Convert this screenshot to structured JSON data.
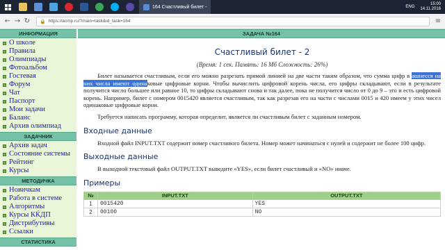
{
  "taskbar": {
    "task_title": "164 Счастливый билет -",
    "lang": "ENG",
    "time": "15:00",
    "date": "14.11.2016"
  },
  "browser": {
    "url": "https://acmp.ru/?main=task&id_task=164"
  },
  "sidebar": {
    "sections": [
      {
        "title": "ИНФОРМАЦИЯ",
        "items": [
          "О школе",
          "Правила",
          "Олимпиады",
          "Фотоальбом",
          "Гостевая",
          "Форум",
          "Чат",
          "Паспорт",
          "Мои задачи",
          "Баланс",
          "Архив олимпиад"
        ]
      },
      {
        "title": "ЗАДАЧНИК",
        "items": [
          "Архив задач",
          "Состояние системы",
          "Рейтинг",
          "Курсы"
        ]
      },
      {
        "title": "МЕТОДИЧКА",
        "items": [
          "Новичкам",
          "Работа в системе",
          "Алгоритмы",
          "Курсы КЌДП",
          "Дистрибутивы",
          "Ссылки"
        ]
      },
      {
        "title": "СТАТИСТИКА",
        "items": []
      }
    ]
  },
  "task": {
    "header": "ЗАДАЧА №164",
    "title": "Счастливый билет - 2",
    "limits": "(Время: 1 сек. Память: 16 Мб Сложность: 26%)",
    "statement_before": "Билет называется счастливым, если его можно разрезать прямой линией на две части таким образом, что сумма цифр в ",
    "statement_highlight": "ашнесся на них числа имеют одина",
    "statement_after": "ковые цифровые корни. Чтобы вычислить цифровой корень числа, его цифры складывают, если в результате получится число большее или равное 10, то цифры складывают снова и так далее, пока не получится число от 0 до 9 – это и есть цифровой корень. Например, билет с номером 0015420 является счастливым, так как разрезав его на части с числами 0015 и 420 имеем у этих чисел одинаковые цифровые корни.",
    "statement_2": "Требуется написать программу, которая определит, является ли счастливым билет с заданным номером.",
    "input_heading": "Входные данные",
    "input_text": "Входной файл INPUT.TXT содержит номер счастливого билета. Номер может начинаться с нулей и содержит не более 100 цифр.",
    "output_heading": "Выходные данные",
    "output_text": "В выходной текстовый файл OUTPUT.TXT выведите «YES», если билет счастливый и «NO» иначе.",
    "examples_heading": "Примеры",
    "table": {
      "headers": [
        "№",
        "INPUT.TXT",
        "OUTPUT.TXT"
      ],
      "rows": [
        [
          "1",
          "0015420",
          "YES"
        ],
        [
          "2",
          "00100",
          "NO"
        ]
      ]
    }
  }
}
